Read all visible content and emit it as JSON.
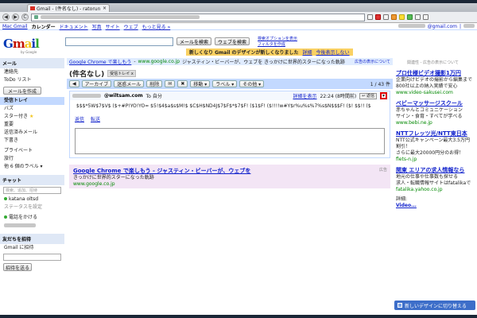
{
  "browser": {
    "tab_title": "Gmail - (件名なし) - ratorun",
    "tab_close": "×",
    "back": "◀",
    "forward": "▶",
    "reload": "C"
  },
  "gbar": {
    "links": [
      "Mac Gmail",
      "カレンダー",
      "ドキュメント",
      "写真",
      "サイト",
      "ウェブ",
      "もっと見る »"
    ],
    "current": "Gmail",
    "account": "@gmail.com",
    "more": "|"
  },
  "header": {
    "logo_sub": "by Google",
    "search_mail": "メールを検索",
    "search_web": "ウェブを検索",
    "links": [
      "検索オプションを表示",
      "フィルタを作成"
    ],
    "promo_text": "新しくなり Gmail のデザインが新しくなりました",
    "promo_link1": "詳細",
    "promo_link2": "今後表示しない"
  },
  "sidebar": {
    "mail_header": "メール",
    "top_items": [
      "連絡先",
      "ToDo リスト"
    ],
    "compose": "メールを作成",
    "items": [
      {
        "label": "受信トレイ",
        "active": true
      },
      {
        "label": "バズ",
        "active": false
      },
      {
        "label": "スター付き",
        "active": false
      },
      {
        "label": "重要",
        "active": false
      },
      {
        "label": "送信済みメール",
        "active": false
      },
      {
        "label": "下書き",
        "active": false
      }
    ],
    "labels": [
      "プライベート",
      "旅行",
      "他 6 個のラベル ▾"
    ],
    "chat_header": "チャット",
    "chat_search": "検索、追加、招待",
    "me_name": "katana oltsd",
    "me_status": "ステータスを設定",
    "call": "電話をかける",
    "invite_header": "友だちを招待",
    "invite_text": "Gmail に招待",
    "invite_btn": "招待を送る"
  },
  "main": {
    "top_ad_title": "Google Chrome で楽しもう",
    "top_ad_url": "www.google.co.jp",
    "top_ad_desc": "ジャスティン・ビーバーが、ウェブを きっかけに世界的スターになった軌跡",
    "top_ad_right": "広告の表示について",
    "subject": "(件名なし)",
    "label": "受信トレイ x",
    "toolbar": [
      "◀",
      "アーカイブ",
      "迷惑メール",
      "削除",
      "✉",
      "✖",
      "移動 ▾",
      "ラベル ▾",
      "その他 ▾"
    ],
    "pager": "1 / 43 件",
    "sender": "@wiltsam.com",
    "to": "To 自分",
    "detail_link": "詳細を表示",
    "date": "22:24 (8時間前)",
    "reply_btn": "↩ 返信",
    "more_btn": "▾",
    "body": "$$$*5W$7$V$ ($+#P!YO!YO= $5!$4$a$s$M!$ $C$H$ND4J$7$F$*$7$F! ($1$F! ($!!!!w#Y$r%u%s%7%s$N$$$F! ($! $$!! ($",
    "reply_link": "返信",
    "forward_link": "転送",
    "bottom_ad_title": "Google Chrome で楽しもう - ジャスティン・ビーバーが、ウェブを",
    "bottom_ad_desc": "きっかけに世界的スターになった軌跡",
    "bottom_ad_url": "www.google.co.jp",
    "bottom_ad_note": "広告"
  },
  "right_ads": {
    "header": "関連性 - 広告の表示について",
    "ads": [
      {
        "title": "プロ仕様ビデオ撮影1万円",
        "desc": [
          "企業向けビデオの撮影から編集まで",
          "800社以上の納入実績で安心"
        ],
        "url": "www.video-sakusei.com"
      },
      {
        "title": "ベビーマッサージスクール",
        "desc": [
          "赤ちゃんとコミュニケーション",
          "サイン・食育・すべてが学べる"
        ],
        "url": "www.bebi.ne.jp"
      },
      {
        "title": "NTTフレッツ光/NTT東日本",
        "desc": [
          "NTT公式キャンペーン最大3.5万円",
          "割引！",
          "さらに最大20000円分のお得！"
        ],
        "url": "flets-n.jp"
      },
      {
        "title": "関東 エリアの求人情報なら",
        "desc": [
          "地元の仕事や仕事数も探せる",
          "求人・転職情報サイトはfatalikaで"
        ],
        "url": "fatalika.yahoo.co.jp"
      }
    ],
    "more": "詳細:",
    "last": "Video..."
  },
  "new_look": "新しいデザインに切り替える"
}
